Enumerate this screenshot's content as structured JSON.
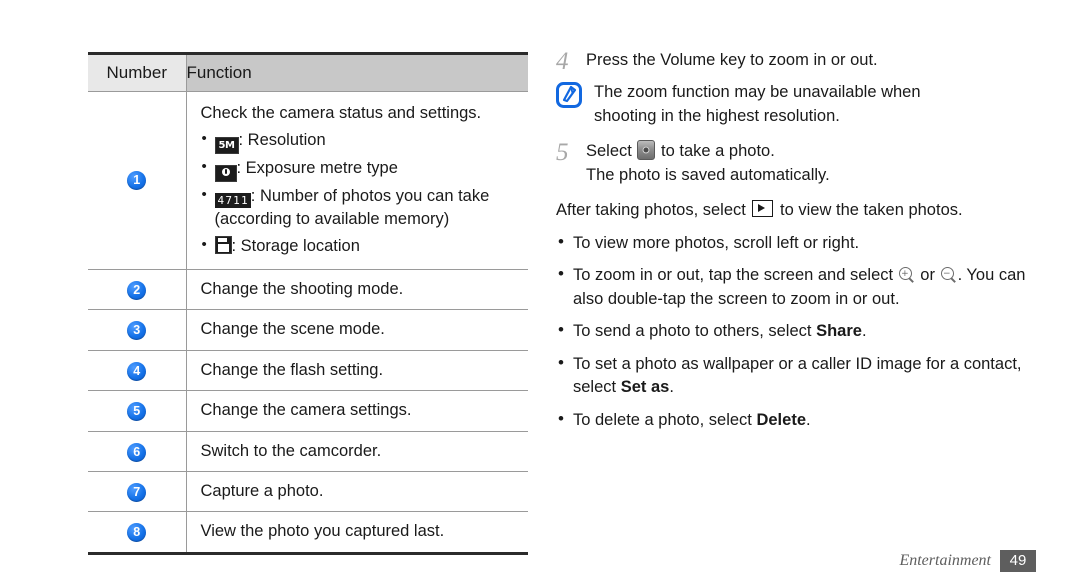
{
  "table": {
    "headers": [
      "Number",
      "Function"
    ],
    "rows": [
      {
        "number": "1",
        "lead": "Check the camera status and settings.",
        "items": [
          {
            "icon": "resolution-icon",
            "icon_text": "5M",
            "text": ": Resolution"
          },
          {
            "icon": "exposure-metre-icon",
            "icon_text": "",
            "text": ": Exposure metre type"
          },
          {
            "icon": "photo-count-icon",
            "icon_text": "4711",
            "text": ": Number of photos you can take (according to available memory)"
          },
          {
            "icon": "storage-location-icon",
            "icon_text": "",
            "text": ": Storage location"
          }
        ]
      },
      {
        "number": "2",
        "lead": "Change the shooting mode."
      },
      {
        "number": "3",
        "lead": "Change the scene mode."
      },
      {
        "number": "4",
        "lead": "Change the flash setting."
      },
      {
        "number": "5",
        "lead": "Change the camera settings."
      },
      {
        "number": "6",
        "lead": "Switch to the camcorder."
      },
      {
        "number": "7",
        "lead": "Capture a photo."
      },
      {
        "number": "8",
        "lead": "View the photo you captured last."
      }
    ]
  },
  "right": {
    "step4": {
      "num": "4",
      "text": "Press the Volume key to zoom in or out."
    },
    "note": {
      "icon": "note-pen-icon",
      "line1": "The zoom function may be unavailable when",
      "line2": "shooting in the highest resolution."
    },
    "step5": {
      "num": "5",
      "before_icon": "Select",
      "icon": "shutter-icon",
      "after_icon": "to take a photo.",
      "sub": "The photo is saved automatically."
    },
    "after": {
      "before_icon": "After taking photos, select",
      "icon": "play-icon",
      "after_icon": "to view the taken photos."
    },
    "tips": [
      {
        "text": "To view more photos, scroll left or right."
      },
      {
        "pre": "To zoom in or out, tap the screen and select",
        "icon_in": "zoom-in-icon",
        "mid": "or",
        "icon_out": "zoom-out-icon",
        "post": ". You can also double-tap the screen to zoom in or out."
      },
      {
        "pre": "To send a photo to others, select ",
        "bold": "Share",
        "post": "."
      },
      {
        "pre": "To set a photo as wallpaper or a caller ID image for a contact, select ",
        "bold": "Set as",
        "post": "."
      },
      {
        "pre": "To delete a photo, select ",
        "bold": "Delete",
        "post": "."
      }
    ]
  },
  "footer": {
    "label": "Entertainment",
    "page": "49"
  },
  "colors": {
    "accent_blue": "#1572e8",
    "header_number_bg": "#e8e8e8",
    "header_function_bg": "#c8c8c8",
    "rule": "#9a9a9a",
    "heavy_rule": "#2b2b2b",
    "footer_gray": "#5e5e5e"
  }
}
